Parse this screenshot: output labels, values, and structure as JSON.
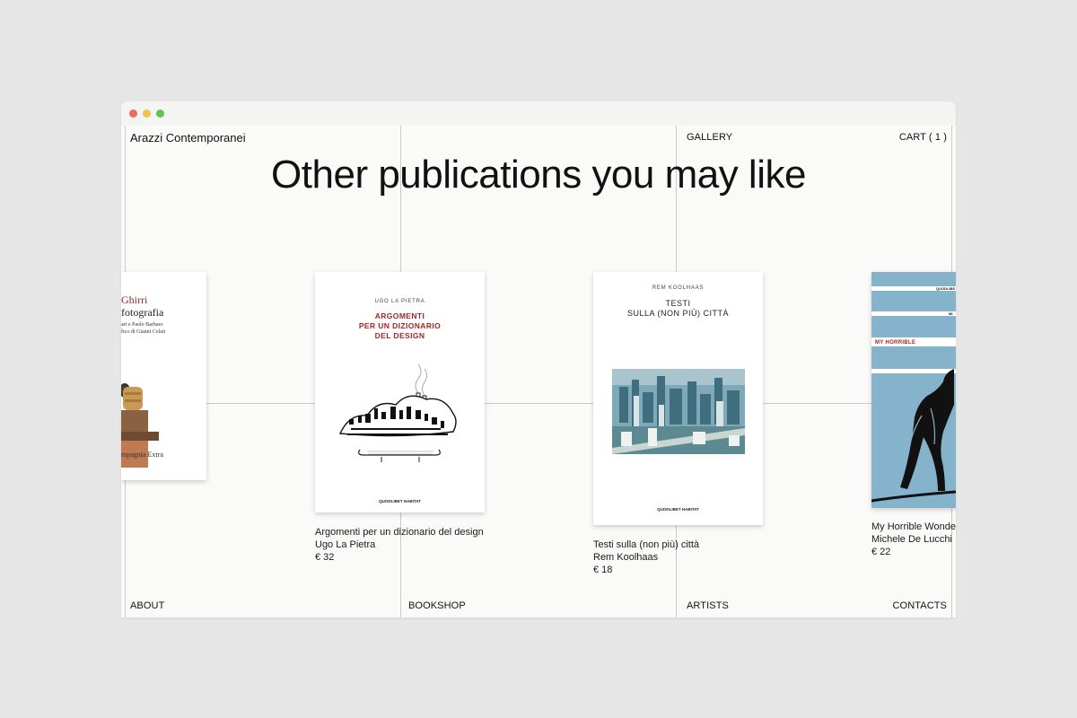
{
  "site": {
    "brand": "Arazzi Contemporanei"
  },
  "nav": {
    "gallery": "GALLERY",
    "cart": "CART ( 1 )",
    "about": "ABOUT",
    "bookshop": "BOOKSHOP",
    "artists": "ARTISTS",
    "contacts": "CONTACTS"
  },
  "heading": "Other publications you may like",
  "books": [
    {
      "cover": {
        "title_line1": "Ghirri",
        "title_line2": "fotografia",
        "line3": "ari e Paolo Barbaro",
        "line4": "fico di Gianni Celati",
        "footer": "mpagnia Extra"
      }
    },
    {
      "cover": {
        "author": "UGO LA PIETRA",
        "title_line1": "ARGOMENTI",
        "title_line2": "PER UN DIZIONARIO",
        "title_line3": "DEL DESIGN",
        "publisher": "QUODLIBET HABITAT"
      },
      "title": "Argomenti per un dizionario del design",
      "author": "Ugo La Pietra",
      "price": "€ 32"
    },
    {
      "cover": {
        "author": "REM KOOLHAAS",
        "title_line1": "TESTI",
        "title_line2": "SULLA (NON PIÙ) CITTÀ",
        "publisher": "QUODLIBET HABITAT"
      },
      "title": "Testi sulla (non più) città",
      "author": "Rem Koolhaas",
      "price": "€ 18"
    },
    {
      "cover": {
        "label1": "QUODLIBE",
        "label2": "MI",
        "title": "MY HORRIBLE"
      },
      "title": "My Horrible Wonder",
      "author": "Michele De Lucchi",
      "price": "€ 22"
    }
  ],
  "colors": {
    "page_bg": "#e6e6e6",
    "window_bg": "#fafaf8",
    "grid_line": "#c9c9c7",
    "cover_red": "#a32626",
    "cover_blue": "#86b3cc"
  }
}
